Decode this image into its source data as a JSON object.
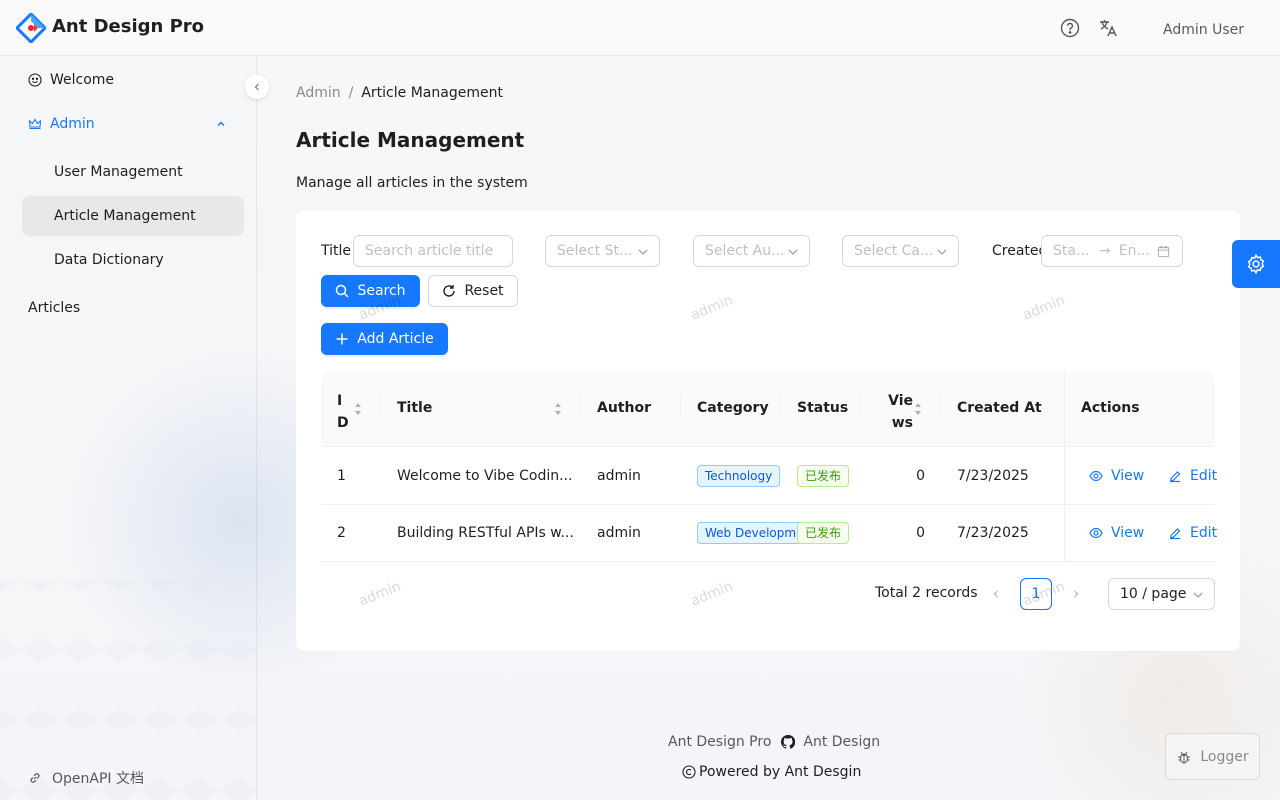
{
  "app": {
    "brand": "Ant Design Pro",
    "user_name": "Admin User"
  },
  "sidebar": {
    "welcome": "Welcome",
    "admin": "Admin",
    "admin_items": [
      "User Management",
      "Article Management",
      "Data Dictionary"
    ],
    "articles": "Articles",
    "openapi": "OpenAPI 文档"
  },
  "breadcrumb": {
    "parent": "Admin",
    "separator": "/",
    "current": "Article Management"
  },
  "page": {
    "title": "Article Management",
    "description": "Manage all articles in the system"
  },
  "filters": {
    "title_label": "Title :",
    "title_placeholder": "Search article title",
    "status_placeholder": "Select St...",
    "author_placeholder": "Select Au...",
    "category_placeholder": "Select Ca...",
    "created_label": "Created",
    "start_placeholder": "Sta...",
    "end_placeholder": "En...",
    "search_button": "Search",
    "reset_button": "Reset"
  },
  "toolbar": {
    "add_button": "Add Article"
  },
  "table": {
    "columns": {
      "id": "ID",
      "title": "Title",
      "author": "Author",
      "category": "Category",
      "status": "Status",
      "views": "Views",
      "created_at": "Created At",
      "actions": "Actions"
    },
    "rows": [
      {
        "id": "1",
        "title": "Welcome to Vibe Codin...",
        "author": "admin",
        "category": "Technology",
        "status": "已发布",
        "views": "0",
        "created_at": "7/23/2025",
        "view_label": "View",
        "edit_label": "Edit"
      },
      {
        "id": "2",
        "title": "Building RESTful APIs w...",
        "author": "admin",
        "category": "Web Developme",
        "status": "已发布",
        "views": "0",
        "created_at": "7/23/2025",
        "view_label": "View",
        "edit_label": "Edit"
      }
    ]
  },
  "pagination": {
    "total_text": "Total 2 records",
    "current_page": "1",
    "page_size": "10 / page"
  },
  "footer": {
    "link1": "Ant Design Pro",
    "link2": "Ant Design",
    "copyright": "Powered by Ant Desgin"
  },
  "watermark": "admin",
  "logger": {
    "label": "Logger"
  },
  "colors": {
    "primary": "#1677ff",
    "success_tag": "#389e0d",
    "info_tag": "#0958d9"
  }
}
